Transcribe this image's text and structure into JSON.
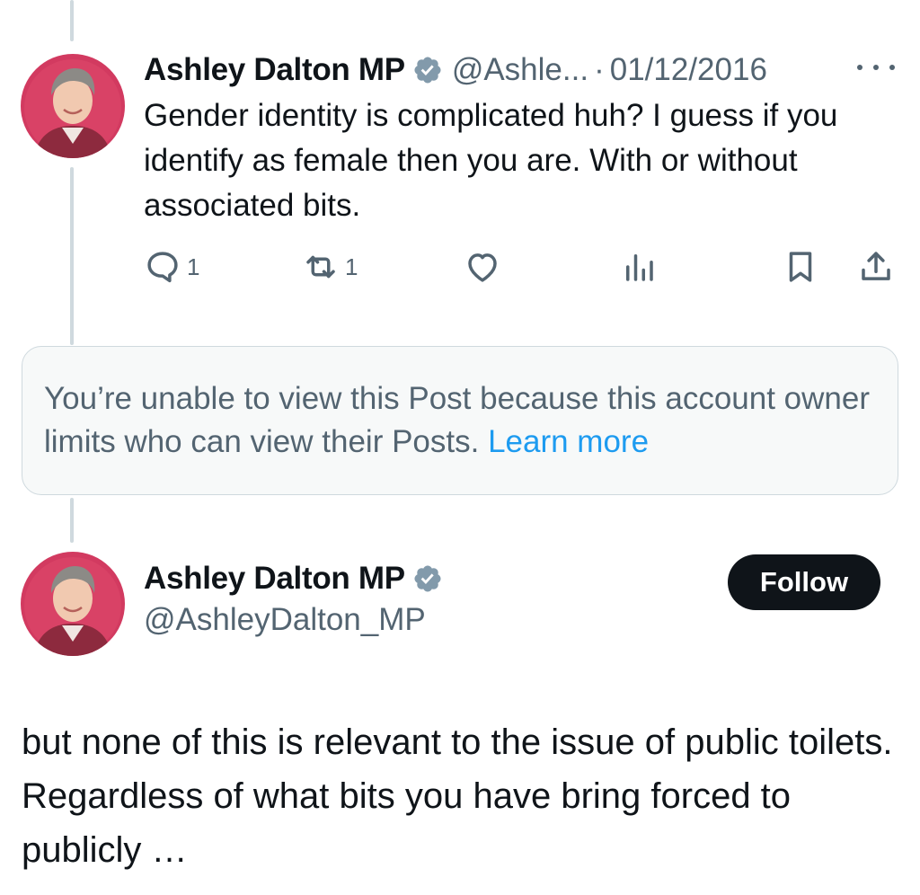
{
  "colors": {
    "text_primary": "#0f1419",
    "text_secondary": "#536471",
    "link": "#1d9bf0",
    "verified_badge": "#829aab",
    "follow_button_bg": "#0f1419",
    "thread_line": "#cfd9de"
  },
  "parent_post": {
    "author_name": "Ashley Dalton MP",
    "verified_icon": "verified-badge-icon",
    "handle": "@Ashle...",
    "separator": "·",
    "date": "01/12/2016",
    "more_icon": "more-options-icon",
    "text": "Gender identity is complicated huh? I guess if you identify as female then you are. With or without associated bits.",
    "actions": {
      "reply": {
        "icon": "reply-icon",
        "count": "1"
      },
      "repost": {
        "icon": "repost-icon",
        "count": "1"
      },
      "like": {
        "icon": "like-icon",
        "count": ""
      },
      "views": {
        "icon": "views-icon",
        "count": ""
      },
      "bookmark": {
        "icon": "bookmark-icon"
      },
      "share": {
        "icon": "share-icon"
      }
    }
  },
  "restricted_notice": {
    "text": "You’re unable to view this Post because this account owner limits who can view their Posts. ",
    "link_text": "Learn more"
  },
  "main_post": {
    "author_name": "Ashley Dalton MP",
    "verified_icon": "verified-badge-icon",
    "handle": "@AshleyDalton_MP",
    "follow_label": "Follow",
    "text": "but none of this is relevant to the issue of public toilets. Regardless of what bits you have bring forced to publicly …"
  }
}
